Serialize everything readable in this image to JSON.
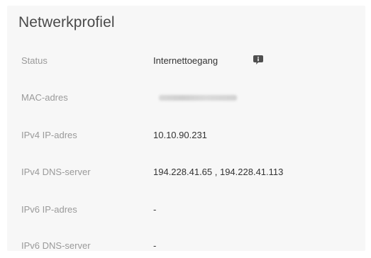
{
  "panel": {
    "title": "Netwerkprofiel"
  },
  "rows": [
    {
      "label": "Status",
      "value": "Internettoegang",
      "icon": "info-icon"
    },
    {
      "label": "MAC-adres",
      "value": "",
      "redacted": true
    },
    {
      "label": "IPv4 IP-adres",
      "value": "10.10.90.231"
    },
    {
      "label": "IPv4 DNS-server",
      "value": "194.228.41.65 , 194.228.41.113"
    },
    {
      "label": "IPv6 IP-adres",
      "value": "-"
    },
    {
      "label": "IPv6 DNS-server",
      "value": "-"
    }
  ],
  "colors": {
    "panel_bg": "#f7f7f7",
    "label": "#9a9a9a",
    "value": "#333333",
    "title": "#4a4a4a"
  }
}
